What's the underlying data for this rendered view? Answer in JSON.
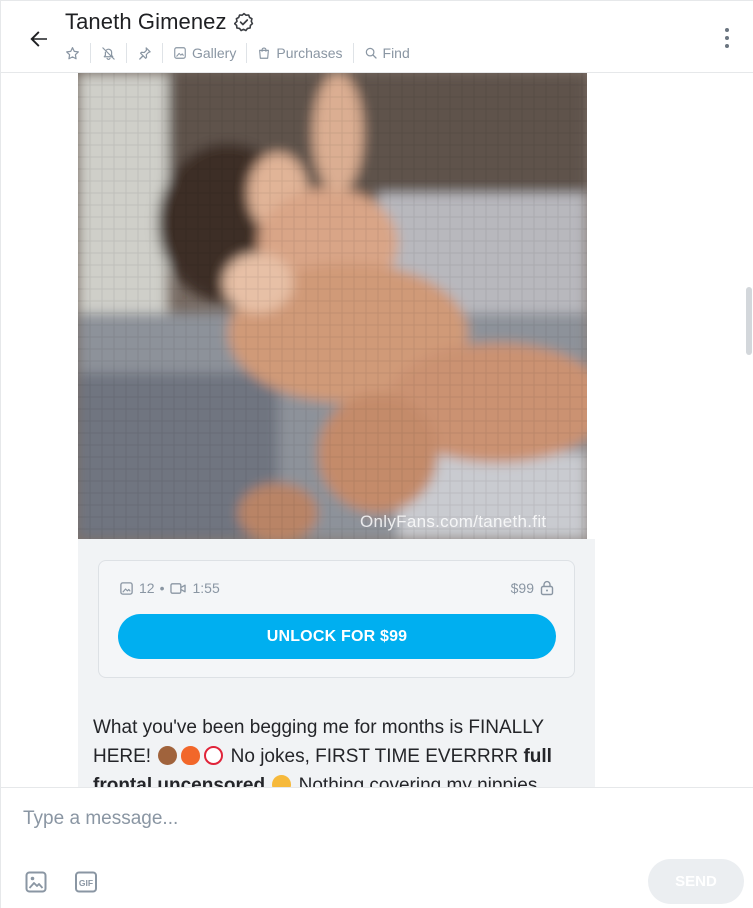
{
  "header": {
    "title": "Taneth Gimenez",
    "verified_icon": "verified-badge-icon",
    "toolbar": {
      "gallery_label": "Gallery",
      "purchases_label": "Purchases",
      "find_label": "Find"
    }
  },
  "message": {
    "media_watermark": "OnlyFans.com/taneth.fit",
    "locked": {
      "photo_count": "12",
      "video_duration": "1:55",
      "price": "$99",
      "unlock_label": "UNLOCK FOR $99"
    },
    "text_part1": "What you've been begging me for months is FINALLY HERE!",
    "text_part2": "No jokes, FIRST TIME EVERRRR",
    "text_bold1": "full frontal uncensored",
    "text_part3": "Nothing covering my nippies"
  },
  "composer": {
    "placeholder": "Type a message...",
    "gif_label": "GIF",
    "send_label": "SEND"
  },
  "colors": {
    "accent": "#00aff0",
    "muted": "#8a96a3",
    "send_disabled": "#ebeef1"
  }
}
